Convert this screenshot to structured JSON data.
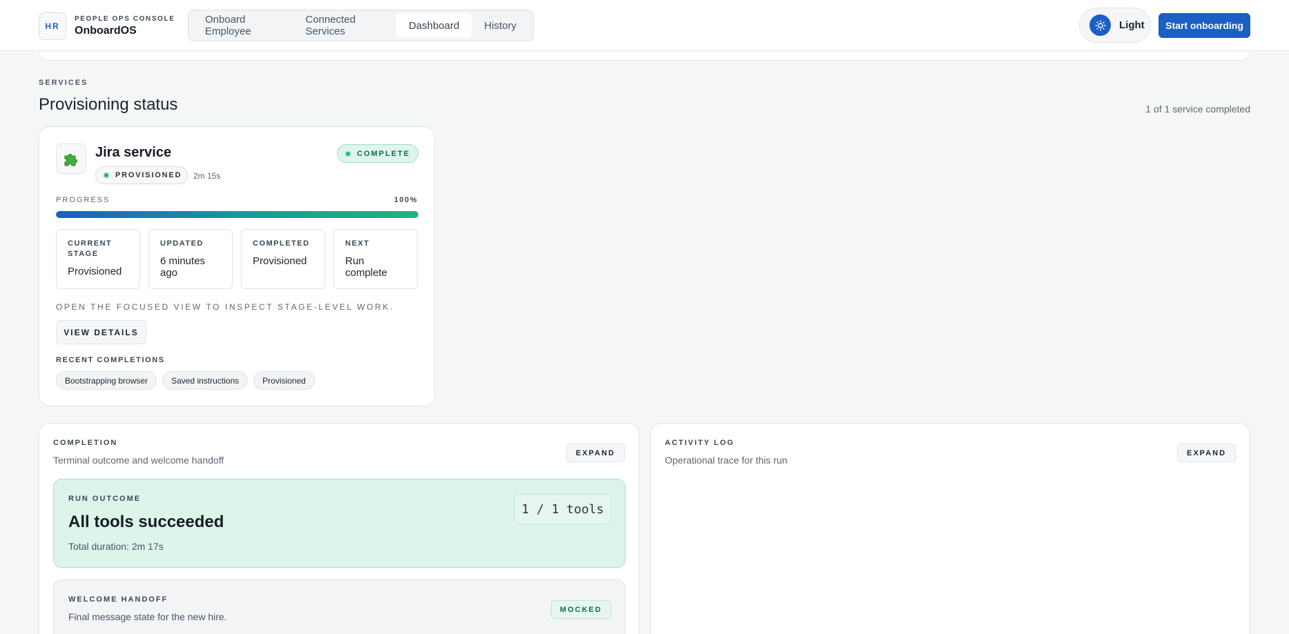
{
  "header": {
    "logo_initials": "HR",
    "eyebrow": "PEOPLE OPS CONSOLE",
    "app_name": "OnboardOS",
    "nav": [
      {
        "label": "Onboard Employee"
      },
      {
        "label": "Connected Services"
      },
      {
        "label": "Dashboard",
        "active": true
      },
      {
        "label": "History"
      }
    ],
    "theme_label": "Light",
    "primary_action": "Start onboarding",
    "accent_color": "#1b5fc4"
  },
  "services": {
    "eyebrow": "SERVICES",
    "title": "Provisioning status",
    "count_text": "1 of 1 service completed",
    "cards": [
      {
        "icon": "puzzle-icon",
        "name": "Jira service",
        "status_pill": "PROVISIONED",
        "duration": "2m 15s",
        "state_badge": "COMPLETE",
        "progress_label": "PROGRESS",
        "progress_text": "100%",
        "progress_value": 1.0,
        "stats": [
          {
            "label": "CURRENT STAGE",
            "value": "Provisioned"
          },
          {
            "label": "UPDATED",
            "value": "6 minutes ago"
          },
          {
            "label": "COMPLETED",
            "value": "Provisioned"
          },
          {
            "label": "NEXT",
            "value": "Run complete"
          }
        ],
        "hint": "OPEN THE FOCUSED VIEW TO INSPECT STAGE-LEVEL WORK.",
        "details_button": "VIEW DETAILS",
        "recent_label": "RECENT COMPLETIONS",
        "recent": [
          "Bootstrapping browser",
          "Saved instructions",
          "Provisioned"
        ]
      }
    ]
  },
  "completion": {
    "eyebrow": "COMPLETION",
    "subtitle": "Terminal outcome and welcome handoff",
    "expand_label": "EXPAND",
    "outcome": {
      "eyebrow": "RUN OUTCOME",
      "title": "All tools succeeded",
      "duration": "Total duration: 2m 17s",
      "tools_badge": "1 / 1 tools"
    },
    "handoff": {
      "eyebrow": "WELCOME HANDOFF",
      "subtitle": "Final message state for the new hire.",
      "badge": "MOCKED"
    }
  },
  "activity": {
    "eyebrow": "ACTIVITY LOG",
    "subtitle": "Operational trace for this run",
    "expand_label": "EXPAND"
  }
}
